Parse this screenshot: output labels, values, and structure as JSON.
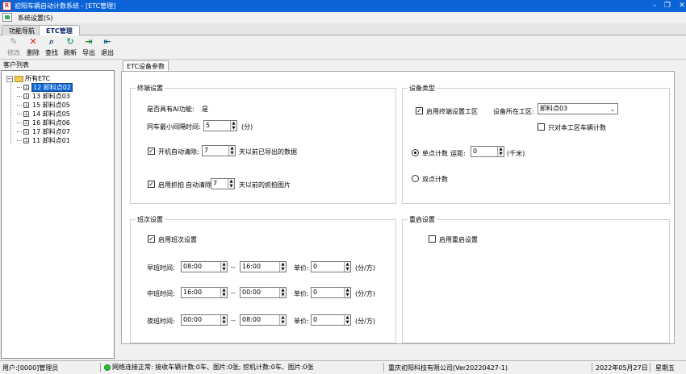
{
  "window": {
    "title": "初阳车辆自动计数系统 - [ETC管理]"
  },
  "menubar": {
    "items": [
      "系统设置(S)"
    ]
  },
  "tabs": [
    {
      "label": "功能导航"
    },
    {
      "label": "ETC管理"
    }
  ],
  "toolbar": {
    "buttons": [
      {
        "label": "修改",
        "icon": "edit-icon"
      },
      {
        "label": "删除",
        "icon": "delete-icon"
      },
      {
        "label": "查找",
        "icon": "search-icon"
      },
      {
        "label": "刷新",
        "icon": "refresh-icon"
      },
      {
        "label": "导出",
        "icon": "export-icon"
      },
      {
        "label": "退出",
        "icon": "exit-icon"
      }
    ]
  },
  "sidebar": {
    "title": "客户列表",
    "root": "所有ETC",
    "nodes": [
      "12 卸料点02",
      "13 卸料点03",
      "15 卸料点05",
      "14 卸料点05",
      "16 卸料点06",
      "17 卸料点07",
      "11 卸料点01"
    ]
  },
  "panel": {
    "tab_label": "ETC设备参数",
    "terminal": {
      "title": "终端设置",
      "ai_label": "是否具有AI功能:",
      "ai_value": "是",
      "interval_label": "同车最小间隔时间:",
      "interval_value": "5",
      "interval_unit": "(分)",
      "autoclear_label": "开机自动清除:",
      "autoclear_value": "7",
      "autoclear_suffix": "天以前已导出的数据",
      "capture_label": "启用抓拍",
      "capture_autoclear_label": "自动清除",
      "capture_value": "7",
      "capture_suffix": "天以前的抓拍图片"
    },
    "device_type": {
      "title": "设备类型",
      "enable_zone_label": "启用终端设置工区",
      "zone_label": "设备所在工区:",
      "zone_value": "卸料点03",
      "count_only_label": "只对本工区车辆计数",
      "single_label": "单点计数",
      "distance_label": "运距:",
      "distance_value": "0",
      "distance_unit": "(千米)",
      "double_label": "双点计数"
    },
    "shift": {
      "title": "班次设置",
      "enable_label": "启用班次设置",
      "sep": "--",
      "price_label": "单价:",
      "price_unit": "(分/方)",
      "rows": [
        {
          "label": "早班时间:",
          "start": "08:00",
          "end": "16:00",
          "price": "0"
        },
        {
          "label": "中班时间:",
          "start": "16:00",
          "end": "00:00",
          "price": "0"
        },
        {
          "label": "夜班时间:",
          "start": "00:00",
          "end": "08:00",
          "price": "0"
        }
      ]
    },
    "restart": {
      "title": "重启设置",
      "enable_label": "启用重启设置"
    }
  },
  "statusbar": {
    "user": "用户:[0000]管理员",
    "network": "网络连接正常: 接收车辆计数:0车、图片:0张; 挖机计数:0车、图片:0张",
    "company": "重庆初阳科技有限公司(Ver20220427-1)",
    "date": "2022年05月27日",
    "weekday": "星期五"
  },
  "colors": {
    "titlebar": "#0a64d6",
    "selection": "#0a64d6",
    "status_ok": "#26c13a"
  }
}
